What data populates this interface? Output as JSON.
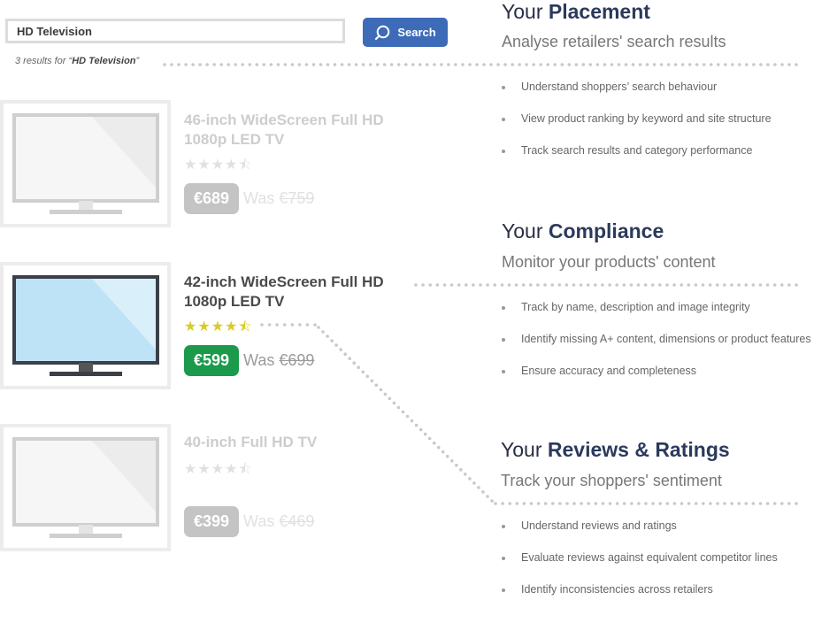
{
  "search": {
    "value": "HD Television",
    "button_label": "Search",
    "results_prefix": "3 results for “",
    "results_query": "HD Television",
    "results_suffix": "”"
  },
  "products": [
    {
      "title": "46-inch WideScreen Full HD 1080p LED TV",
      "rating": 4.5,
      "price": "€689",
      "was_label": "Was",
      "was_price": "€759",
      "state": "muted"
    },
    {
      "title": "42-inch WideScreen Full HD 1080p LED TV",
      "rating": 4.5,
      "price": "€599",
      "was_label": "Was",
      "was_price": "€699",
      "state": "active"
    },
    {
      "title": "40-inch Full HD TV",
      "rating": 4.5,
      "price": "€399",
      "was_label": "Was",
      "was_price": "€469",
      "state": "muted"
    }
  ],
  "sections": {
    "placement": {
      "prefix": "Your",
      "name": "Placement",
      "subtitle": "Analyse retailers' search results",
      "bullets": [
        "Understand shoppers’ search behaviour",
        "View product ranking by keyword and site structure",
        "Track search results and category performance"
      ]
    },
    "compliance": {
      "prefix": "Your",
      "name": "Compliance",
      "subtitle": "Monitor your products' content",
      "bullets": [
        "Track by name, description and image integrity",
        "Identify missing A+ content, dimensions or product features",
        "Ensure accuracy and completeness"
      ]
    },
    "reviews": {
      "prefix": "Your",
      "name": "Reviews & Ratings",
      "subtitle": "Track your shoppers' sentiment",
      "bullets": [
        "Understand reviews and ratings",
        "Evaluate reviews against equivalent competitor lines",
        "Identify inconsistencies across retailers"
      ]
    }
  },
  "colors": {
    "brand_blue": "#3d6bb8",
    "heading_navy": "#2b3a5c",
    "active_price_green": "#1a9a4a",
    "muted_price_grey": "#c4c4c4",
    "star_gold": "#d8cc2a",
    "screen_blue": "#bfe3f6"
  },
  "icons": {
    "search_button_icon": "search-icon",
    "tv_icon": "tv-icon",
    "star_icon": "star-icon"
  }
}
